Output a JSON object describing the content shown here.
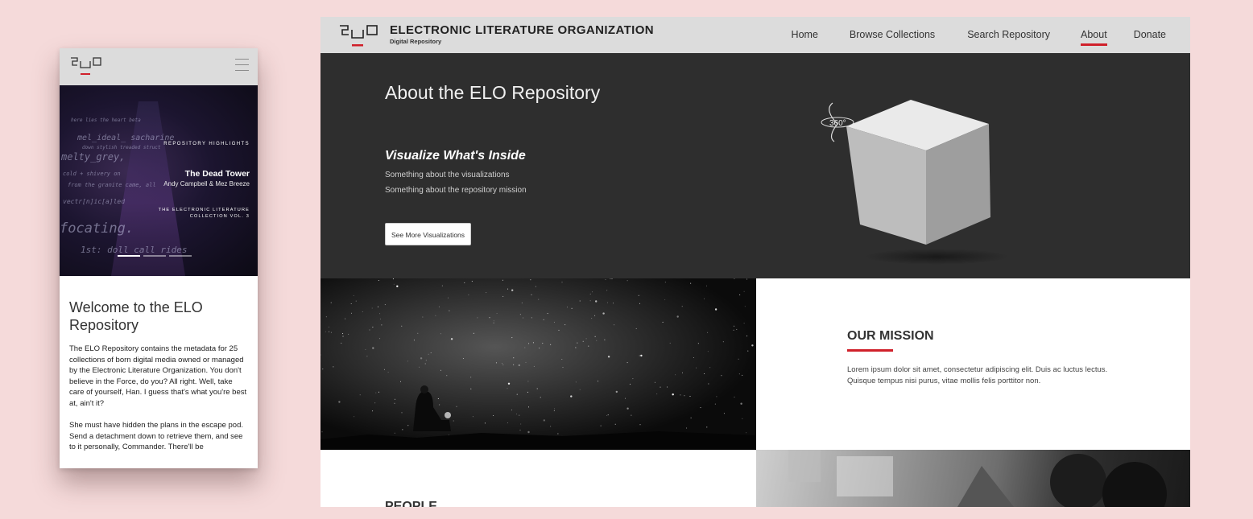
{
  "mobile": {
    "hero": {
      "code_lines": [
        "here lies the heart beta",
        "mel_ideal_ sacharine",
        "down stylish treaded struct",
        "melty_grey,",
        "cold + shivery on",
        "from the granite came, all",
        "vectr[n]ic[a]led",
        "focating.",
        "1st: doll call rides"
      ],
      "highlights_label": "REPOSITORY HIGHLIGHTS",
      "title": "The Dead Tower",
      "author": "Andy Campbell & Mez Breeze",
      "collection": "THE ELECTRONIC LITERATURE COLLECTION VOL. 3"
    },
    "welcome_title": "Welcome to the ELO Repository",
    "paragraph1": "The ELO Repository contains the metadata for 25 collections of born digital media owned or managed by the Electronic Literature Organization. You don't believe in the Force, do you? All right. Well, take care of yourself, Han. I guess that's what you're best at, ain't it?",
    "paragraph2": "She must have hidden the plans in the escape pod. Send a detachment down to retrieve them, and see to it personally, Commander. There'll be"
  },
  "desktop": {
    "brand": {
      "title": "ELECTRONIC LITERATURE ORGANIZATION",
      "subtitle": "Digital Repository"
    },
    "nav": [
      "Home",
      "Browse Collections",
      "Search Repository",
      "About",
      "Donate"
    ],
    "active_nav": "About",
    "hero": {
      "heading": "About the ELO Repository",
      "subheading": "Visualize What's Inside",
      "line1": "Something about the visualizations",
      "line2": "Something about the repository mission",
      "button": "See More Visualizations",
      "rotate_label": "360°"
    },
    "mission": {
      "heading": "OUR MISSION",
      "text": "Lorem ipsum dolor sit amet, consectetur adipiscing elit. Duis ac luctus lectus. Quisque tempus nisi purus, vitae mollis felis porttitor non."
    },
    "people_heading": "PEOPLE"
  },
  "colors": {
    "background": "#f5dada",
    "accent": "#d0202a",
    "header_bg": "#dcdcdc",
    "hero_bg": "#2e2e2e"
  }
}
